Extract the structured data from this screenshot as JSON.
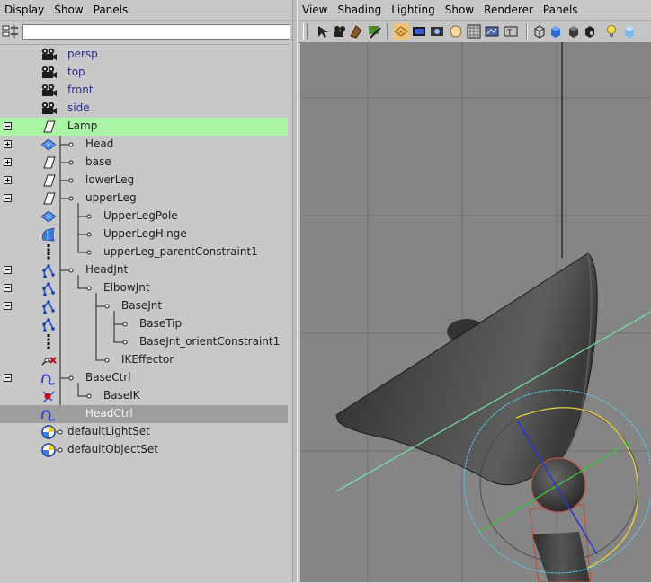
{
  "outliner": {
    "menu": [
      "Display",
      "Show",
      "Panels"
    ],
    "search": {
      "value": ""
    },
    "items": [
      {
        "label": "persp",
        "kind": "camera",
        "depth": 0
      },
      {
        "label": "top",
        "kind": "camera",
        "depth": 0
      },
      {
        "label": "front",
        "kind": "camera",
        "depth": 0
      },
      {
        "label": "side",
        "kind": "camera",
        "depth": 0
      },
      {
        "label": "Lamp",
        "kind": "transform",
        "depth": 0,
        "expander": "minus",
        "selected": "primary"
      },
      {
        "label": "Head",
        "kind": "mesh",
        "depth": 1,
        "expander": "plus"
      },
      {
        "label": "base",
        "kind": "transform",
        "depth": 1,
        "expander": "plus"
      },
      {
        "label": "lowerLeg",
        "kind": "transform",
        "depth": 1,
        "expander": "plus"
      },
      {
        "label": "upperLeg",
        "kind": "transform",
        "depth": 1,
        "expander": "minus"
      },
      {
        "label": "UpperLegPole",
        "kind": "mesh",
        "depth": 2
      },
      {
        "label": "UpperLegHinge",
        "kind": "nurbs",
        "depth": 2
      },
      {
        "label": "upperLeg_parentConstraint1",
        "kind": "constraint",
        "depth": 2
      },
      {
        "label": "HeadJnt",
        "kind": "joint",
        "depth": 1,
        "expander": "minus"
      },
      {
        "label": "ElbowJnt",
        "kind": "joint",
        "depth": 2,
        "expander": "minus"
      },
      {
        "label": "BaseJnt",
        "kind": "joint",
        "depth": 3,
        "expander": "minus"
      },
      {
        "label": "BaseTip",
        "kind": "joint",
        "depth": 4
      },
      {
        "label": "BaseJnt_orientConstraint1",
        "kind": "constraint",
        "depth": 4
      },
      {
        "label": "IKEffector",
        "kind": "effector",
        "depth": 3
      },
      {
        "label": "BaseCtrl",
        "kind": "curve",
        "depth": 1,
        "expander": "minus"
      },
      {
        "label": "BaseIK",
        "kind": "ikhandle",
        "depth": 2
      },
      {
        "label": "HeadCtrl",
        "kind": "curve",
        "depth": 1,
        "selected": "secondary"
      },
      {
        "label": "defaultLightSet",
        "kind": "set",
        "depth": 0
      },
      {
        "label": "defaultObjectSet",
        "kind": "set",
        "depth": 0
      }
    ]
  },
  "viewport": {
    "menu": [
      "View",
      "Shading",
      "Lighting",
      "Show",
      "Renderer",
      "Panels"
    ],
    "toolbar_icons": [
      "select-camera-icon",
      "camera-attributes-icon",
      "bookmarks-icon",
      "image-plane-icon",
      "grid-icon",
      "film-gate-icon",
      "resolution-gate-icon",
      "gate-mask-icon",
      "field-chart-icon",
      "safe-action-icon",
      "safe-title-icon",
      "wireframe-icon",
      "smooth-shade-icon",
      "default-material-icon",
      "textured-icon",
      "use-lights-icon",
      "shadows-icon"
    ]
  },
  "colors": {
    "selection_primary": "#a9f5a4",
    "selection_secondary": "#9e9e9e",
    "camera_label": "#2a2a92",
    "viewport_bg": "#858585",
    "grid_line": "#6f6f6f"
  }
}
